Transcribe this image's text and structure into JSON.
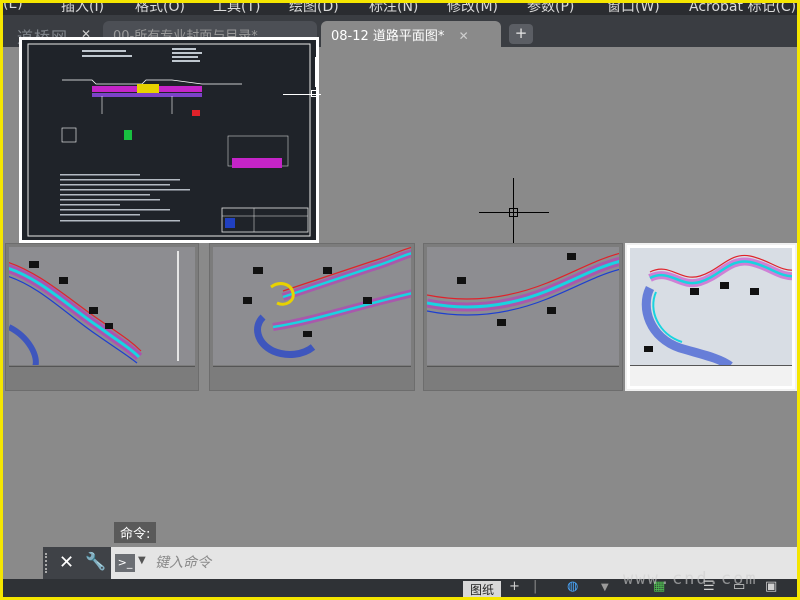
{
  "menu": {
    "items": [
      "(E)",
      "插入(I)",
      "格式(O)",
      "工具(T)",
      "绘图(D)",
      "标注(N)",
      "修改(M)",
      "参数(P)",
      "窗口(W)",
      "Acrobat 标记(C)"
    ]
  },
  "watermark_logo": "道桥网",
  "tabs": [
    {
      "label": "00-所有专业封面与目录*",
      "active": false
    },
    {
      "label": "08-12 道路平面图*",
      "active": true
    }
  ],
  "command": {
    "label": "命令:",
    "placeholder": "键入命令"
  },
  "status": {
    "paper_tab": "图纸",
    "add": "+"
  },
  "site_watermark": "www.cnd.com",
  "colors": {
    "frame": "#f5e600",
    "canvas": "#8a8a8a",
    "road_red": "#e0222a",
    "road_cyan": "#18d4e0",
    "road_blue": "#1d3fd0",
    "hatch_magenta": "#c524c8"
  }
}
